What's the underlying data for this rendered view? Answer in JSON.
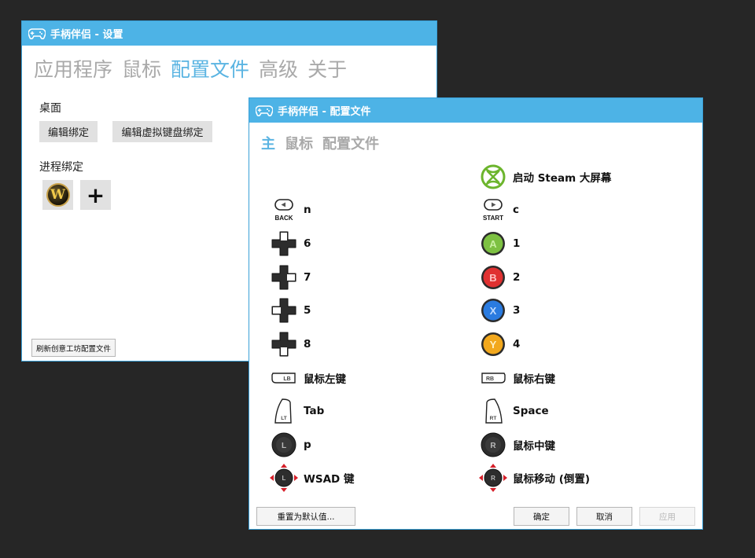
{
  "settings_window": {
    "title": "手柄伴侣 - 设置",
    "tabs": [
      {
        "label": "应用程序",
        "active": false
      },
      {
        "label": "鼠标",
        "active": false
      },
      {
        "label": "配置文件",
        "active": true
      },
      {
        "label": "高级",
        "active": false
      },
      {
        "label": "关于",
        "active": false
      }
    ],
    "desktop_label": "桌面",
    "edit_binding_button": "编辑绑定",
    "edit_vkb_binding_button": "编辑虚拟键盘绑定",
    "process_binding_label": "进程绑定",
    "wow_icon_letter": "W",
    "add_process_glyph": "+",
    "refresh_button": "刷新创意工坊配置文件"
  },
  "profile_window": {
    "title": "手柄伴侣 - 配置文件",
    "tabs": [
      {
        "label": "主",
        "active": true
      },
      {
        "label": "鼠标",
        "active": false
      },
      {
        "label": "配置文件",
        "active": false
      }
    ],
    "guide_binding": "启动 Steam 大屏幕",
    "left_column": [
      {
        "button": "back",
        "icon_text": "BACK",
        "binding": "n"
      },
      {
        "button": "dpad-up",
        "icon_text": "",
        "binding": "6"
      },
      {
        "button": "dpad-right",
        "icon_text": "",
        "binding": "7"
      },
      {
        "button": "dpad-left",
        "icon_text": "",
        "binding": "5"
      },
      {
        "button": "dpad-down",
        "icon_text": "",
        "binding": "8"
      },
      {
        "button": "lb",
        "icon_text": "LB",
        "binding": "鼠标左键"
      },
      {
        "button": "lt",
        "icon_text": "LT",
        "binding": "Tab"
      },
      {
        "button": "left-stick-click",
        "icon_text": "L",
        "binding": "p"
      },
      {
        "button": "left-stick-move",
        "icon_text": "L",
        "binding": "WSAD 键"
      }
    ],
    "right_column": [
      {
        "button": "start",
        "icon_text": "START",
        "binding": "c"
      },
      {
        "button": "a",
        "icon_text": "A",
        "color": "#7dc142",
        "binding": "1"
      },
      {
        "button": "b",
        "icon_text": "B",
        "color": "#e03131",
        "binding": "2"
      },
      {
        "button": "x",
        "icon_text": "X",
        "color": "#2a7be0",
        "binding": "3"
      },
      {
        "button": "y",
        "icon_text": "Y",
        "color": "#f2a81d",
        "binding": "4"
      },
      {
        "button": "rb",
        "icon_text": "RB",
        "binding": "鼠标右键"
      },
      {
        "button": "rt",
        "icon_text": "RT",
        "binding": "Space"
      },
      {
        "button": "right-stick-click",
        "icon_text": "R",
        "binding": "鼠标中键"
      },
      {
        "button": "right-stick-move",
        "icon_text": "R",
        "binding": "鼠标移动 (倒置)"
      }
    ],
    "reset_button": "重置为默认值...",
    "ok_button": "确定",
    "cancel_button": "取消",
    "apply_button": "应用"
  },
  "colors": {
    "titlebar": "#4db3e6",
    "active_tab": "#5ab4e2",
    "inactive_tab": "#a9a9a9",
    "xbox_green": "#6cb52d"
  }
}
